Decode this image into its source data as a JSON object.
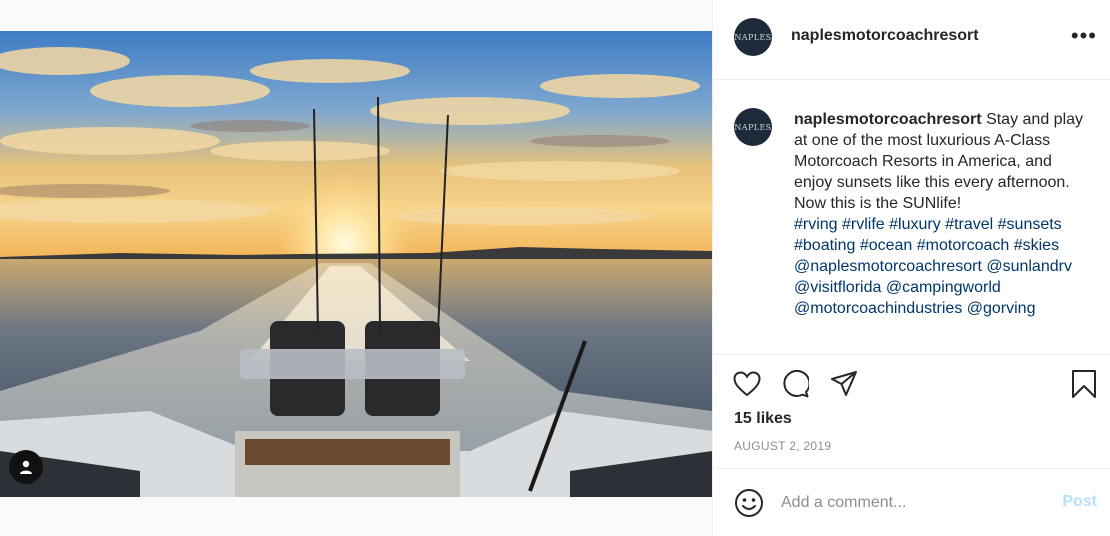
{
  "header": {
    "username": "naplesmotorcoachresort",
    "avatar_text": "NAPLES",
    "more_label": "•••"
  },
  "caption": {
    "username": "naplesmotorcoachresort",
    "text": "Stay and play at one of the most luxurious A-Class Motorcoach Resorts in America, and enjoy sunsets like this every afternoon.",
    "line2": "Now this is the SUNlife!",
    "hashtags": "#rving #rvlife #luxury #travel #sunsets #boating #ocean #motorcoach #skies",
    "mentions": "@naplesmotorcoachresort @sunlandrv @visitflorida @campingworld @motorcoachindustries @gorving"
  },
  "stats": {
    "likes": "15 likes",
    "date": "AUGUST 2, 2019"
  },
  "comment": {
    "placeholder": "Add a comment...",
    "post_label": "Post"
  },
  "icons": {
    "like": "heart-icon",
    "comment": "comment-icon",
    "share": "share-icon",
    "save": "bookmark-icon",
    "emoji": "emoji-icon",
    "tag": "user-tag-icon"
  }
}
